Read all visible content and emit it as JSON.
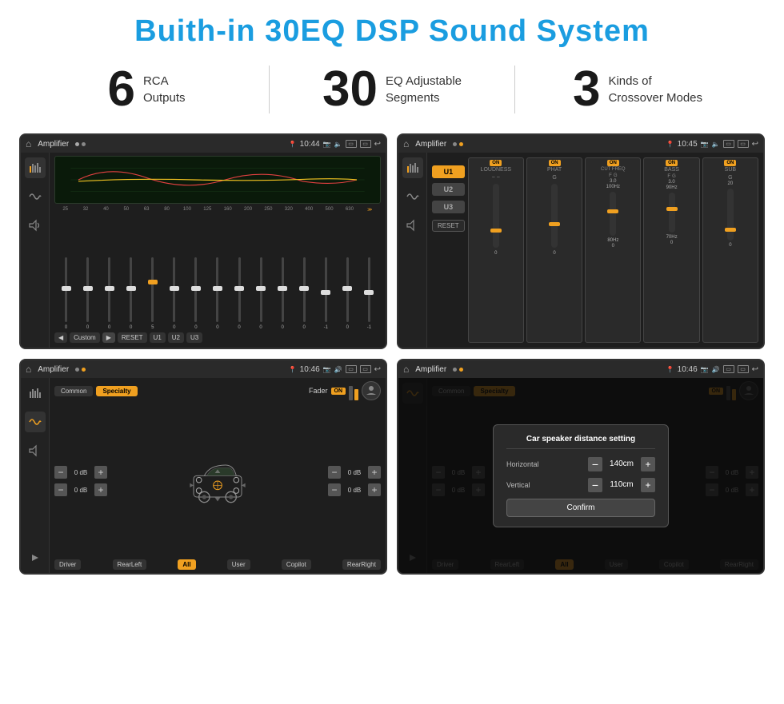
{
  "page": {
    "title": "Buith-in 30EQ DSP Sound System",
    "title_color": "#1a9de0"
  },
  "stats": [
    {
      "number": "6",
      "label_line1": "RCA",
      "label_line2": "Outputs"
    },
    {
      "divider": true
    },
    {
      "number": "30",
      "label_line1": "EQ Adjustable",
      "label_line2": "Segments"
    },
    {
      "divider": true
    },
    {
      "number": "3",
      "label_line1": "Kinds of",
      "label_line2": "Crossover Modes"
    }
  ],
  "screens": [
    {
      "id": "screen1",
      "status_bar": {
        "title": "Amplifier",
        "time": "10:44"
      },
      "type": "eq"
    },
    {
      "id": "screen2",
      "status_bar": {
        "title": "Amplifier",
        "time": "10:45"
      },
      "type": "channels"
    },
    {
      "id": "screen3",
      "status_bar": {
        "title": "Amplifier",
        "time": "10:46"
      },
      "type": "fader"
    },
    {
      "id": "screen4",
      "status_bar": {
        "title": "Amplifier",
        "time": "10:46"
      },
      "type": "fader_dialog"
    }
  ],
  "eq": {
    "frequencies": [
      "25",
      "32",
      "40",
      "50",
      "63",
      "80",
      "100",
      "125",
      "160",
      "200",
      "250",
      "320",
      "400",
      "500",
      "630"
    ],
    "values": [
      "0",
      "0",
      "0",
      "0",
      "5",
      "0",
      "0",
      "0",
      "0",
      "0",
      "0",
      "0",
      "-1",
      "0",
      "-1"
    ],
    "preset": "Custom",
    "buttons": [
      "RESET",
      "U1",
      "U2",
      "U3"
    ]
  },
  "channels": {
    "units": [
      "U1",
      "U2",
      "U3"
    ],
    "groups": [
      "LOUDNESS",
      "PHAT",
      "CUT FREQ",
      "BASS",
      "SUB"
    ],
    "reset_label": "RESET"
  },
  "fader": {
    "tabs": [
      "Common",
      "Specialty"
    ],
    "fader_label": "Fader",
    "on_label": "ON",
    "left_top_db": "0 dB",
    "left_bottom_db": "0 dB",
    "right_top_db": "0 dB",
    "right_bottom_db": "0 dB",
    "bottom_buttons": [
      "Driver",
      "RearLeft",
      "All",
      "User",
      "Copilot",
      "RearRight"
    ]
  },
  "dialog": {
    "title": "Car speaker distance setting",
    "horizontal_label": "Horizontal",
    "horizontal_value": "140cm",
    "vertical_label": "Vertical",
    "vertical_value": "110cm",
    "confirm_label": "Confirm",
    "right_top_db": "0 dB",
    "right_bottom_db": "0 dB"
  }
}
